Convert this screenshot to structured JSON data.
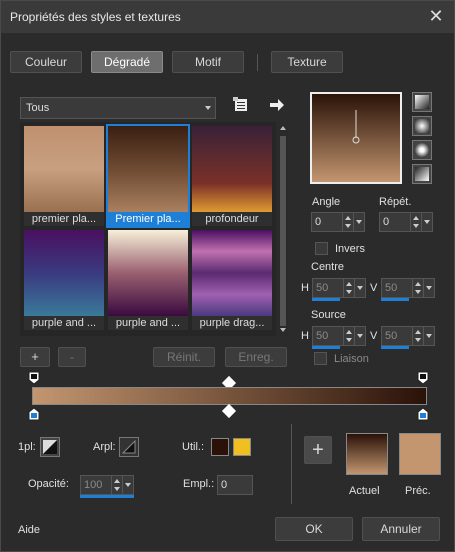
{
  "window": {
    "title": "Propriétés des styles et textures",
    "close_glyph": "✕"
  },
  "tabs": [
    {
      "label": "Couleur",
      "active": false
    },
    {
      "label": "Dégradé",
      "active": true
    },
    {
      "label": "Motif",
      "active": false
    },
    {
      "label": "Texture",
      "active": false
    }
  ],
  "category": {
    "selected": "Tous"
  },
  "gradients": [
    {
      "label": "premier pla...",
      "colors": [
        "#c09070",
        "#c8a080",
        "#9a7050"
      ],
      "selected": false
    },
    {
      "label": "Premier pla...",
      "colors": [
        "#3a1f12",
        "#6e4a32",
        "#a98060"
      ],
      "selected": true
    },
    {
      "label": "profondeur",
      "colors": [
        "#3a2038",
        "#5a2a30",
        "#7a3028",
        "#e09a30"
      ],
      "selected": false
    },
    {
      "label": "purple and ...",
      "colors": [
        "#4a1060",
        "#3a3a80",
        "#3a7a9a"
      ],
      "selected": false
    },
    {
      "label": "purple and ...",
      "colors": [
        "#f6f0d8",
        "#9a6070",
        "#3a0a40"
      ],
      "selected": false
    },
    {
      "label": "purple drag...",
      "colors": [
        "#4a1060",
        "#c070b0",
        "#5a2a70",
        "#a060b0",
        "#4a3a80"
      ],
      "selected": false
    }
  ],
  "buttons": {
    "add": "+",
    "remove": "-",
    "reset": "Réinit.",
    "save": "Enreg."
  },
  "preview": {
    "colors": [
      "#2a1208",
      "#c39670"
    ]
  },
  "angle": {
    "label": "Angle",
    "value": "0"
  },
  "repeat": {
    "label": "Répét.",
    "value": "0"
  },
  "invert": {
    "label": "Invers",
    "checked": false
  },
  "center": {
    "label": "Centre",
    "h_label": "H",
    "h_value": "50",
    "v_label": "V",
    "v_value": "50"
  },
  "source": {
    "label": "Source",
    "h_label": "H",
    "h_value": "50",
    "v_label": "V",
    "v_value": "50"
  },
  "link": {
    "label": "Liaison",
    "checked": false
  },
  "gradient_bar": {
    "colors": [
      "#c39670",
      "#2a1208"
    ]
  },
  "style_row": {
    "fg_label": "1pl:",
    "bg_label": "Arpl:",
    "use_label": "Util.:",
    "use_color_1": "#2a1208",
    "use_color_2": "#f0c020"
  },
  "opacity": {
    "label": "Opacité:",
    "value": "100"
  },
  "location": {
    "label": "Empl.:",
    "value": "0"
  },
  "current": {
    "label": "Actuel",
    "colors": [
      "#2a1208",
      "#c39670"
    ]
  },
  "previous": {
    "label": "Préc.",
    "color": "#c39670"
  },
  "footer": {
    "help": "Aide",
    "ok": "OK",
    "cancel": "Annuler"
  }
}
